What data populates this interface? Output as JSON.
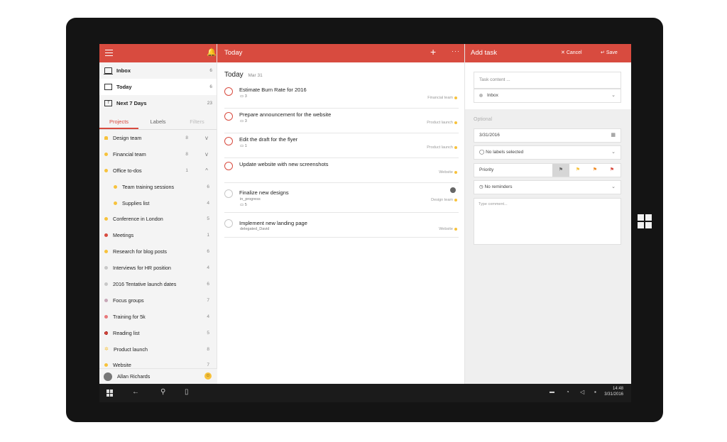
{
  "sidebar": {
    "nav": [
      {
        "label": "Inbox",
        "count": "6",
        "icon": "inbox-icon"
      },
      {
        "label": "Today",
        "count": "6",
        "icon": "today-icon"
      },
      {
        "label": "Next 7 Days",
        "count": "23",
        "icon": "calendar-7-icon"
      }
    ],
    "tabs": [
      "Projects",
      "Labels",
      "Filters"
    ],
    "projects": [
      {
        "label": "Design team",
        "count": "8",
        "color": "#f7c23c",
        "chevron": "v"
      },
      {
        "label": "Financial team",
        "count": "8",
        "color": "#f7c23c",
        "chevron": "v"
      },
      {
        "label": "Office to-dos",
        "count": "1",
        "color": "#f7c23c",
        "chevron": "^"
      },
      {
        "label": "Team training sessions",
        "count": "6",
        "color": "#f7c23c"
      },
      {
        "label": "Supplies list",
        "count": "4",
        "color": "#f7c23c"
      },
      {
        "label": "Conference in London",
        "count": "5",
        "color": "#f7c23c"
      },
      {
        "label": "Meetings",
        "count": "1",
        "color": "#d84b3f"
      },
      {
        "label": "Research for blog posts",
        "count": "6",
        "color": "#f7c23c"
      },
      {
        "label": "Interviews for HR position",
        "count": "4",
        "color": "#c8c8c8"
      },
      {
        "label": "2016 Tentative launch dates",
        "count": "6",
        "color": "#c8c8c8"
      },
      {
        "label": "Focus groups",
        "count": "7",
        "color": "#c8a8b8"
      },
      {
        "label": "Training for 5k",
        "count": "4",
        "color": "#e8787a"
      },
      {
        "label": "Reading list",
        "count": "5",
        "color": "#8b0000"
      },
      {
        "label": "Product launch",
        "count": "8",
        "color": "#f7c23c"
      },
      {
        "label": "Website",
        "count": "7",
        "color": "#f7c23c"
      }
    ],
    "user": "Allan Richards"
  },
  "main": {
    "header_title": "Today",
    "day_title": "Today",
    "day_date": "Mar 31",
    "tasks": [
      {
        "title": "Estimate Burn Rate for 2016",
        "meta": "3",
        "project": "Financial team"
      },
      {
        "title": "Prepare announcement for the website",
        "meta": "3",
        "project": "Product launch"
      },
      {
        "title": "Edit the draft for the flyer",
        "meta": "1",
        "project": "Product launch"
      },
      {
        "title": "Update website with new screenshots",
        "meta": "",
        "project": "Website"
      },
      {
        "title": "Finalize new designs",
        "meta": "in_progress",
        "meta2": "5",
        "project": "Design team"
      },
      {
        "title": "Implement new landing page",
        "meta": "delegated_David",
        "project": "Website"
      }
    ]
  },
  "add_task": {
    "title": "Add task",
    "cancel": "Cancel",
    "save": "Save",
    "content_placeholder": "Task content ...",
    "project": "Inbox",
    "optional_label": "Optional",
    "date": "3/31/2016",
    "labels": "No labels selected",
    "priority_label": "Priority",
    "reminders": "No reminders",
    "comment_placeholder": "Type comment..."
  },
  "taskbar": {
    "time": "14:48",
    "date": "3/31/2016"
  },
  "colors": {
    "accent": "#d84b3f",
    "priority_flags": [
      "#666666",
      "#f7c23c",
      "#f08a24",
      "#d84b3f"
    ]
  }
}
